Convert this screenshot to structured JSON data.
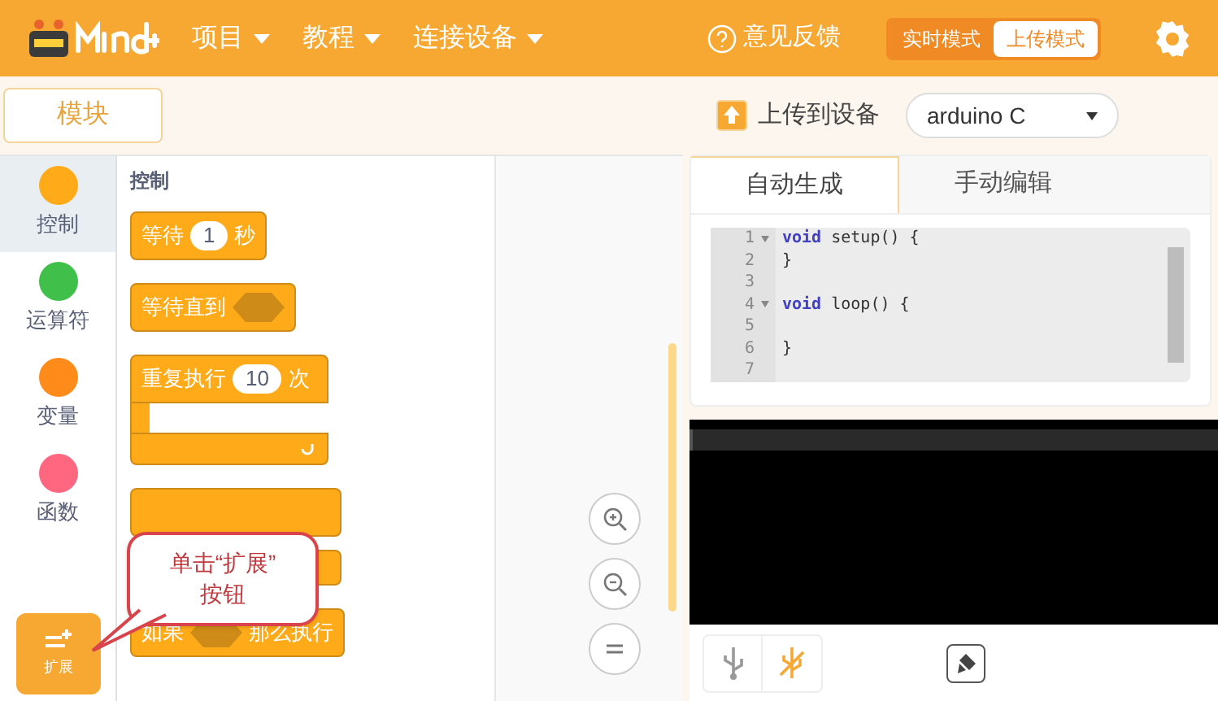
{
  "menu": [
    {
      "label": "项目"
    },
    {
      "label": "教程"
    },
    {
      "label": "连接设备"
    }
  ],
  "feedback": "意见反馈",
  "modes": [
    {
      "label": "实时模式",
      "selected": false
    },
    {
      "label": "上传模式",
      "selected": true
    }
  ],
  "blocks_tab": "模块",
  "upload_button": "上传到设备",
  "device_select": {
    "value": "arduino C"
  },
  "categories": [
    {
      "label": "控制",
      "color": "#ffab19",
      "selected": true
    },
    {
      "label": "运算符",
      "color": "#40bf4a",
      "selected": false
    },
    {
      "label": "变量",
      "color": "#ff8c1a",
      "selected": false
    },
    {
      "label": "函数",
      "color": "#ff6680",
      "selected": false
    }
  ],
  "extension_button": "扩展",
  "palette_title": "控制",
  "blocks": [
    {
      "kind": "stack",
      "parts": [
        {
          "kind": "text",
          "text": "等待"
        },
        {
          "kind": "number",
          "text": "1"
        },
        {
          "kind": "text",
          "text": "秒"
        }
      ]
    },
    {
      "kind": "stack",
      "parts": [
        {
          "kind": "text",
          "text": "等待直到"
        },
        {
          "kind": "slot"
        }
      ]
    },
    {
      "kind": "loop",
      "parts": [
        {
          "kind": "text",
          "text": "重复执行"
        },
        {
          "kind": "number",
          "text": "10"
        },
        {
          "kind": "text",
          "text": "次"
        }
      ]
    },
    {
      "kind": "covered"
    },
    {
      "kind": "stack",
      "parts": [
        {
          "kind": "text",
          "text": "如果"
        },
        {
          "kind": "slot"
        },
        {
          "kind": "text",
          "text": "那么执行"
        }
      ]
    }
  ],
  "callout": {
    "line1": "单击“扩展”",
    "line2": "按钮"
  },
  "code_tabs": [
    {
      "label": "自动生成",
      "selected": true
    },
    {
      "label": "手动编辑",
      "selected": false
    }
  ],
  "code_lines": [
    {
      "number": "1",
      "fold": true,
      "tokens": [
        {
          "kind": "keyword",
          "text": "void"
        },
        {
          "kind": "plain",
          "text": " setup() {"
        }
      ]
    },
    {
      "number": "2",
      "fold": false,
      "tokens": [
        {
          "kind": "plain",
          "text": "}"
        }
      ]
    },
    {
      "number": "3",
      "fold": false
    },
    {
      "number": "4",
      "fold": true,
      "tokens": [
        {
          "kind": "keyword",
          "text": "void"
        },
        {
          "kind": "plain",
          "text": " loop() {"
        }
      ]
    },
    {
      "number": "5",
      "fold": false
    },
    {
      "number": "6",
      "fold": false,
      "tokens": [
        {
          "kind": "plain",
          "text": "}"
        }
      ]
    },
    {
      "number": "7",
      "fold": false
    }
  ]
}
